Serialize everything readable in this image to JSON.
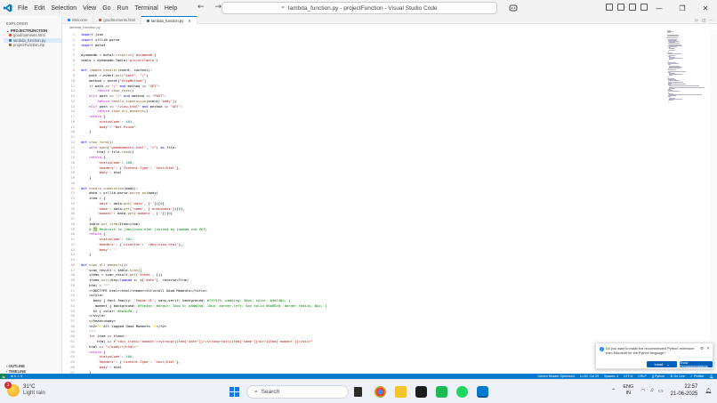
{
  "window": {
    "menu": [
      "File",
      "Edit",
      "Selection",
      "View",
      "Go",
      "Run",
      "Terminal",
      "Help"
    ],
    "command_center": "lambda_function.py - projectFunction - Visual Studio Code"
  },
  "sidebar": {
    "header": "EXPLORER",
    "section": "PROJECTFUNCTION",
    "files": [
      {
        "name": "goodmoments.html",
        "icon_color": "#e44d26"
      },
      {
        "name": "lambda_function.py",
        "icon_color": "#3572a5"
      },
      {
        "name": "projectFunction.zip",
        "icon_color": "#8b6f3a"
      }
    ],
    "outline": "OUTLINE",
    "timeline": "TIMELINE"
  },
  "tabs": [
    {
      "label": "Welcome",
      "icon_color": "#1a85ff",
      "active": false
    },
    {
      "label": "goodmoments.html",
      "icon_color": "#e44d26",
      "active": false
    },
    {
      "label": "lambda_function.py",
      "icon_color": "#3572a5",
      "active": true
    }
  ],
  "breadcrumb": "lambda_function.py",
  "code_lines": [
    "import json",
    "import urllib.parse",
    "import boto3",
    "",
    "dynamodb = boto3.resource('dynamodb')",
    "table = dynamodb.Table('projectTable')",
    "",
    "def lambda_handler(event, context):",
    "    path = event.get(\"path\", \"/\")",
    "    method = event[\"httpMethod\"]",
    "    if path == \"/\" and method == \"GET\":",
    "        return show_form()",
    "    elif path == \"/\" and method == \"POST\":",
    "        return handle_submission(event['body'])",
    "    elif path == \"/view.html\" and method == \"GET\":",
    "        return show_all_moments()",
    "    return {",
    "        'statusCode': 404,",
    "        'body': \"Not Found\"",
    "    }",
    "",
    "def show_form():",
    "    with open(\"goodmoments.html\", \"r\") as file:",
    "        html = file.read()",
    "    return {",
    "        'statusCode': 200,",
    "        'headers': {'Content-Type': 'text/html'},",
    "        'body': html",
    "    }",
    "",
    "def handle_submission(body):",
    "    data = urllib.parse.parse_qs(body)",
    "    item = {",
    "        'date': data.get('date', [''])[0],",
    "        'name': data.get('name', ['Anonymous'])[0],",
    "        'moment': data.get('moment', [''])[0]",
    "    }",
    "    table.put_item(Item=item)",
    "    # ✅ Redirect to /dev/view.html (served by Lambda via GET)",
    "    return {",
    "        'statusCode': 302,",
    "        'headers': {'Location': '/dev/view.html'},",
    "        'body': ''",
    "    }",
    "",
    "def show_all_moments():",
    "    scan_result = table.scan()",
    "    items = scan_result.get('Items', [])",
    "    items.sort(key=lambda x: x['date'], reverse=True)",
    "    html = \"\"\"",
    "    <!DOCTYPE html><html><head><title>All Good Moments</title>",
    "    <style>",
    "      body { font-family: 'Segoe UI', sans-serif; background: #fff5f5; padding: 30px; color: #4a148c; }",
    "      .moment { background: #fce4ec; margin: 15px 0; padding: 15px; border-left: 5px solid #ba68c8; border-radius: 8px; }",
    "      h2 { color: #6a1b9a; }",
    "    </style>",
    "    </head><body>",
    "    <h2>✨ All Logged Good Moments ✨</h2>",
    "    \"\"\"",
    "    for item in items:",
    "        html += f\"<div class='moment'><strong>{item['date']}</strong><br>{item['name']}<br>{item['moment']}</div>\"",
    "    html += \"</body></html>\"",
    "    return {",
    "        'statusCode': 200,",
    "        'headers': {'Content-Type': 'text/html'},",
    "        'body': html",
    "    }"
  ],
  "notification": {
    "message": "Do you want to install the recommended 'Python' extension from Microsoft for the Python language?",
    "install_label": "Install",
    "recommendations_label": "Show Recommendations"
  },
  "statusbar": {
    "errors": "⊗ 0  ⚠ 0",
    "items": [
      "Screen Reader Optimized",
      "Ln 62, Col 29",
      "Spaces: 4",
      "UTF-8",
      "CRLF",
      "{} Python",
      "⚙ Go Live",
      "✓ Prettier"
    ]
  },
  "taskbar": {
    "weather_temp": "31°C",
    "weather_desc": "Light rain",
    "weather_badge": "1",
    "search_placeholder": "Search",
    "lang_top": "ENG",
    "lang_bottom": "IN",
    "time": "22:57",
    "date": "21-06-2025"
  },
  "colors": {
    "accent": "#007acc",
    "install_button": "#005fb8"
  }
}
